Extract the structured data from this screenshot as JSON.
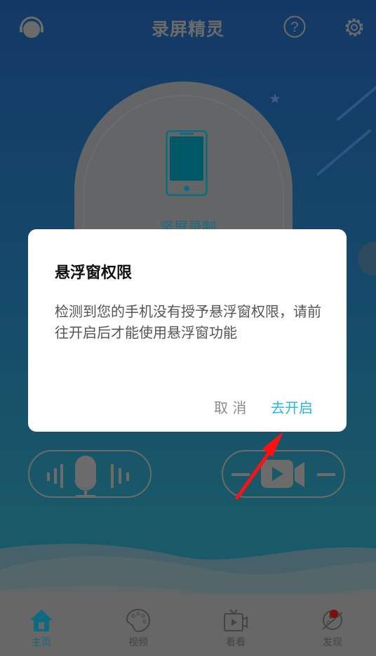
{
  "header": {
    "title": "录屏精灵",
    "icons": [
      "headset-support-icon",
      "help-icon",
      "settings-icon"
    ]
  },
  "main": {
    "vertical_record_label": "竖屏录制",
    "icons": [
      "phone-icon",
      "microphone-icon",
      "video-camera-icon"
    ]
  },
  "dialog": {
    "title": "悬浮窗权限",
    "message": "检测到您的手机没有授予悬浮窗权限，请前往开启后才能使用悬浮窗功能",
    "cancel_label": "取 消",
    "confirm_label": "去开启",
    "confirm_color": "#29b6e0"
  },
  "bottom_nav": {
    "items": [
      {
        "label": "主页",
        "icon": "home-icon",
        "active": true
      },
      {
        "label": "视频",
        "icon": "palette-icon"
      },
      {
        "label": "看看",
        "icon": "tv-icon"
      },
      {
        "label": "发现",
        "icon": "planet-icon",
        "badge": true
      }
    ],
    "active_color": "#0e6a80",
    "badge_color": "#7a1010"
  },
  "annotation": {
    "arrow_color": "#ff1010"
  }
}
